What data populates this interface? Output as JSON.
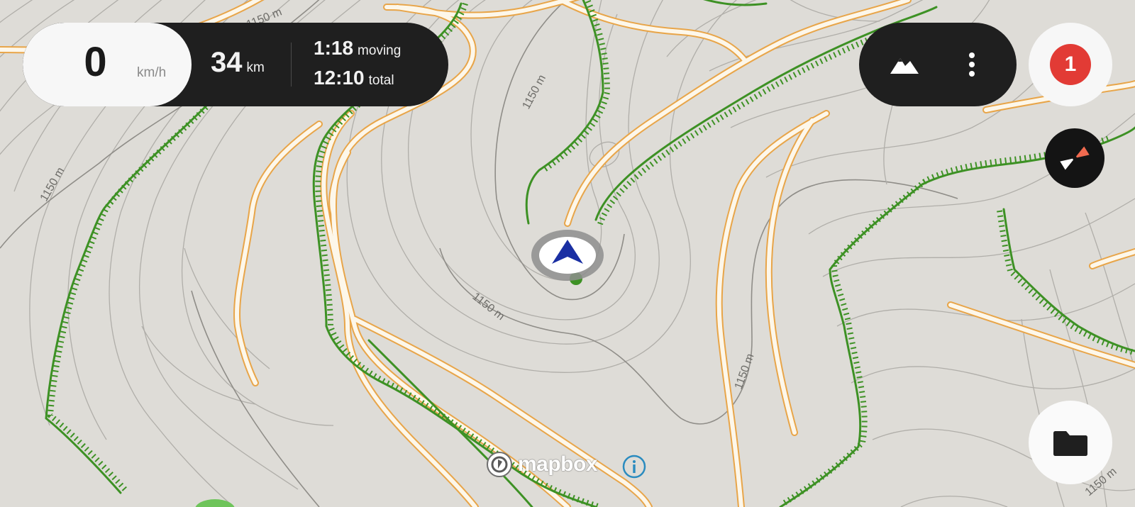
{
  "stats": {
    "speed_value": "0",
    "speed_unit": "km/h",
    "distance_value": "34",
    "distance_unit": "km",
    "moving_time": "1:18",
    "moving_label": "moving",
    "total_time": "12:10",
    "total_label": "total"
  },
  "controls": {
    "terrain_icon": "mountain-icon",
    "more_icon": "more-vert-icon"
  },
  "notifications": {
    "count": "1",
    "color": "#e23b35"
  },
  "compass": {
    "icon": "compass-icon",
    "needle_color": "#f06a4f"
  },
  "folder": {
    "icon": "folder-icon"
  },
  "map": {
    "contour_label": "1150 m",
    "attribution_logo": "mapbox",
    "info_icon": "info-icon",
    "colors": {
      "background": "#dedcd7",
      "contour": "#a9a9a5",
      "road_fill": "#fdf7ea",
      "road_casing": "#e8a549",
      "cliff": "#3d9124",
      "position_marker": "#1a2fa3"
    }
  }
}
